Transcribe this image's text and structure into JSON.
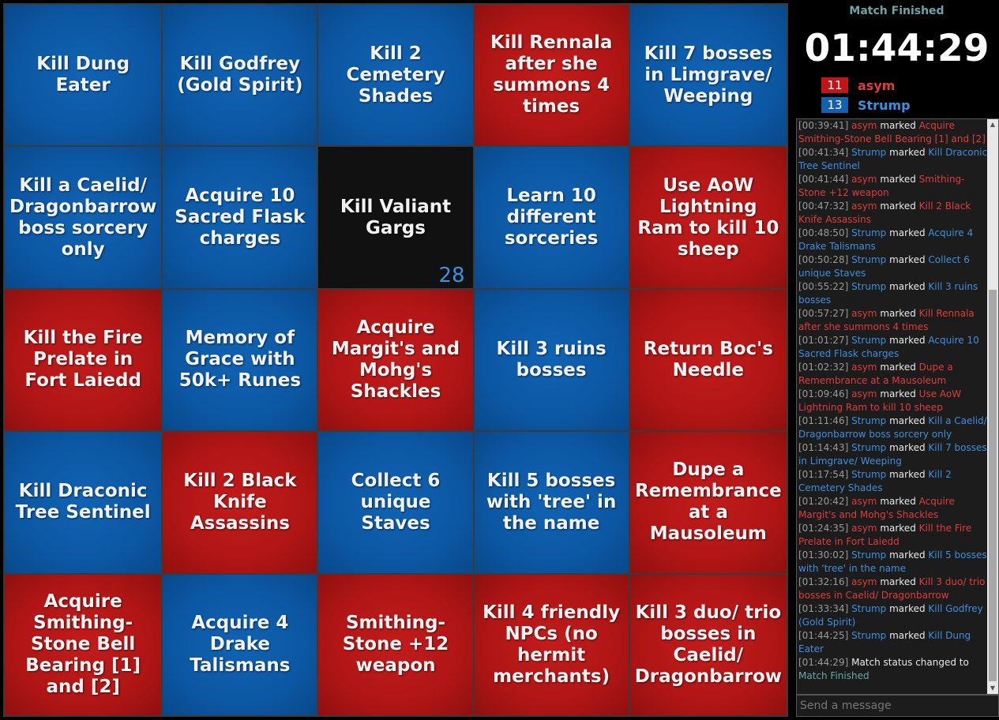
{
  "board": {
    "cells": [
      {
        "text": "Kill Dung Eater",
        "color": "blue"
      },
      {
        "text": "Kill Godfrey (Gold Spirit)",
        "color": "blue"
      },
      {
        "text": "Kill 2 Cemetery Shades",
        "color": "blue"
      },
      {
        "text": "Kill Rennala after she summons 4 times",
        "color": "red"
      },
      {
        "text": "Kill 7 bosses in Limgrave/ Weeping",
        "color": "blue"
      },
      {
        "text": "Kill a Caelid/ Dragonbarrow boss sorcery only",
        "color": "blue"
      },
      {
        "text": "Acquire 10 Sacred Flask charges",
        "color": "blue"
      },
      {
        "text": "Kill Valiant Gargs",
        "color": "black",
        "count": "28"
      },
      {
        "text": "Learn 10 different sorceries",
        "color": "blue"
      },
      {
        "text": "Use AoW Lightning Ram to kill 10 sheep",
        "color": "red"
      },
      {
        "text": "Kill the Fire Prelate in Fort Laiedd",
        "color": "red"
      },
      {
        "text": "Memory of Grace with 50k+ Runes",
        "color": "blue"
      },
      {
        "text": "Acquire Margit's and Mohg's Shackles",
        "color": "red"
      },
      {
        "text": "Kill 3 ruins bosses",
        "color": "blue"
      },
      {
        "text": "Return Boc's Needle",
        "color": "red"
      },
      {
        "text": "Kill Draconic Tree Sentinel",
        "color": "blue"
      },
      {
        "text": "Kill 2 Black Knife Assassins",
        "color": "red"
      },
      {
        "text": "Collect 6 unique Staves",
        "color": "blue"
      },
      {
        "text": "Kill 5 bosses with 'tree' in the name",
        "color": "blue"
      },
      {
        "text": "Dupe a Remembrance at a Mausoleum",
        "color": "red"
      },
      {
        "text": "Acquire Smithing-Stone Bell Bearing [1] and [2]",
        "color": "red"
      },
      {
        "text": "Acquire 4 Drake Talismans",
        "color": "blue"
      },
      {
        "text": "Smithing-Stone +12 weapon",
        "color": "red"
      },
      {
        "text": "Kill 4 friendly NPCs (no hermit merchants)",
        "color": "red"
      },
      {
        "text": "Kill 3 duo/ trio bosses in Caelid/ Dragonbarrow",
        "color": "red"
      }
    ]
  },
  "sidebar": {
    "status": "Match Finished",
    "timer": "01:44:29",
    "players": [
      {
        "score": "11",
        "name": "asym",
        "color": "red"
      },
      {
        "score": "13",
        "name": "Strump",
        "color": "blue"
      }
    ]
  },
  "log": [
    {
      "ts": "[00:39:41]",
      "who": "asym",
      "color": "red",
      "verb": "marked",
      "what": "Acquire Smithing-Stone Bell Bearing [1] and [2]"
    },
    {
      "ts": "[00:41:34]",
      "who": "Strump",
      "color": "blue",
      "verb": "marked",
      "what": "Kill Draconic Tree Sentinel"
    },
    {
      "ts": "[00:41:44]",
      "who": "asym",
      "color": "red",
      "verb": "marked",
      "what": "Smithing-Stone +12 weapon"
    },
    {
      "ts": "[00:47:32]",
      "who": "asym",
      "color": "red",
      "verb": "marked",
      "what": "Kill 2 Black Knife Assassins"
    },
    {
      "ts": "[00:48:50]",
      "who": "Strump",
      "color": "blue",
      "verb": "marked",
      "what": "Acquire 4 Drake Talismans"
    },
    {
      "ts": "[00:50:28]",
      "who": "Strump",
      "color": "blue",
      "verb": "marked",
      "what": "Collect 6 unique Staves"
    },
    {
      "ts": "[00:55:22]",
      "who": "Strump",
      "color": "blue",
      "verb": "marked",
      "what": "Kill 3 ruins bosses"
    },
    {
      "ts": "[00:57:27]",
      "who": "asym",
      "color": "red",
      "verb": "marked",
      "what": "Kill Rennala after she summons 4 times"
    },
    {
      "ts": "[01:01:27]",
      "who": "Strump",
      "color": "blue",
      "verb": "marked",
      "what": "Acquire 10 Sacred Flask charges"
    },
    {
      "ts": "[01:02:32]",
      "who": "asym",
      "color": "red",
      "verb": "marked",
      "what": "Dupe a Remembrance at a Mausoleum"
    },
    {
      "ts": "[01:09:46]",
      "who": "asym",
      "color": "red",
      "verb": "marked",
      "what": "Use AoW Lightning Ram to kill 10 sheep"
    },
    {
      "ts": "[01:11:46]",
      "who": "Strump",
      "color": "blue",
      "verb": "marked",
      "what": "Kill a Caelid/ Dragonbarrow boss sorcery only"
    },
    {
      "ts": "[01:14:43]",
      "who": "Strump",
      "color": "blue",
      "verb": "marked",
      "what": "Kill 7 bosses in Limgrave/ Weeping"
    },
    {
      "ts": "[01:17:54]",
      "who": "Strump",
      "color": "blue",
      "verb": "marked",
      "what": "Kill 2 Cemetery Shades"
    },
    {
      "ts": "[01:20:42]",
      "who": "asym",
      "color": "red",
      "verb": "marked",
      "what": "Acquire Margit's and Mohg's Shackles"
    },
    {
      "ts": "[01:24:35]",
      "who": "asym",
      "color": "red",
      "verb": "marked",
      "what": "Kill the Fire Prelate in Fort Laiedd"
    },
    {
      "ts": "[01:30:02]",
      "who": "Strump",
      "color": "blue",
      "verb": "marked",
      "what": "Kill 5 bosses with 'tree' in the name"
    },
    {
      "ts": "[01:32:16]",
      "who": "asym",
      "color": "red",
      "verb": "marked",
      "what": "Kill 3 duo/ trio bosses in Caelid/ Dragonbarrow"
    },
    {
      "ts": "[01:33:34]",
      "who": "Strump",
      "color": "blue",
      "verb": "marked",
      "what": "Kill Godfrey (Gold Spirit)"
    },
    {
      "ts": "[01:44:25]",
      "who": "Strump",
      "color": "blue",
      "verb": "marked",
      "what": "Kill Dung Eater"
    },
    {
      "ts": "[01:44:29]",
      "who": "",
      "color": "",
      "verb": "Match status changed to",
      "what": "Match Finished",
      "whatColor": "teal"
    }
  ],
  "message": {
    "placeholder": "Send a message"
  },
  "scroll": {
    "up_icon": "▲",
    "down_icon": "▼"
  }
}
